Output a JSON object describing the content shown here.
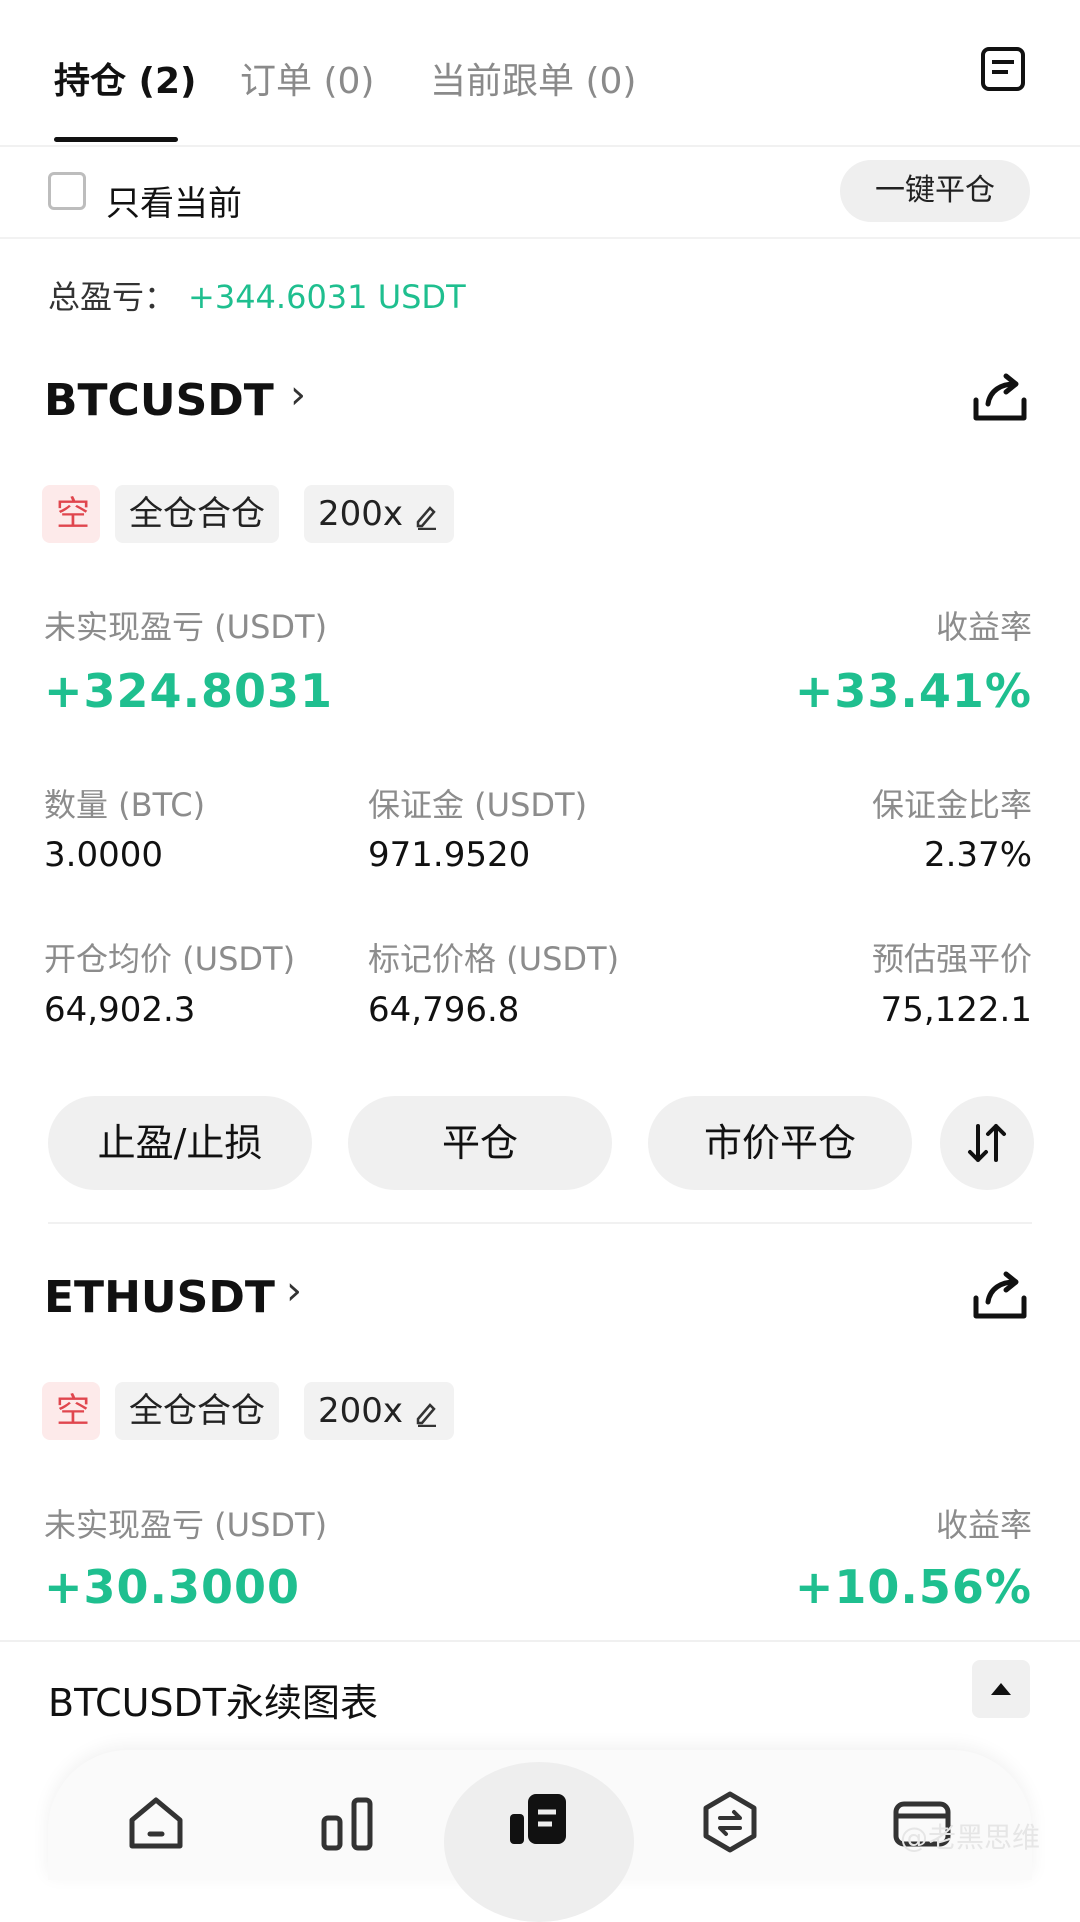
{
  "tabs": [
    {
      "label": "持仓 (2)"
    },
    {
      "label": "订单 (0)"
    },
    {
      "label": "当前跟单 (0)"
    }
  ],
  "filter": {
    "checkbox_label": "只看当前",
    "close_all_label": "一键平仓"
  },
  "summary": {
    "total_pnl_label": "总盈亏：",
    "total_pnl_value": "+344.6031 USDT"
  },
  "positions": [
    {
      "symbol": "BTCUSDT",
      "side_badge": "空",
      "margin_mode": "全仓合仓",
      "leverage": "200x",
      "unrealized_label": "未实现盈亏 (USDT)",
      "unrealized_value": "+324.8031",
      "roe_label": "收益率",
      "roe_value": "+33.41%",
      "qty_label": "数量 (BTC)",
      "qty_value": "3.0000",
      "margin_label": "保证金 (USDT)",
      "margin_value": "971.9520",
      "margin_ratio_label": "保证金比率",
      "margin_ratio_value": "2.37%",
      "entry_label": "开仓均价 (USDT)",
      "entry_value": "64,902.3",
      "mark_label": "标记价格 (USDT)",
      "mark_value": "64,796.8",
      "liq_label": "预估强平价",
      "liq_value": "75,122.1",
      "actions": [
        "止盈/止损",
        "平仓",
        "市价平仓"
      ]
    },
    {
      "symbol": "ETHUSDT",
      "side_badge": "空",
      "margin_mode": "全仓合仓",
      "leverage": "200x",
      "unrealized_label": "未实现盈亏 (USDT)",
      "unrealized_value": "+30.3000",
      "roe_label": "收益率",
      "roe_value": "+10.56%"
    }
  ],
  "chart_bar": {
    "title": "BTCUSDT永续图表"
  },
  "watermark": "@老黑思维",
  "colors": {
    "profit_green": "#1fbf8f",
    "short_red": "#e0464e"
  }
}
